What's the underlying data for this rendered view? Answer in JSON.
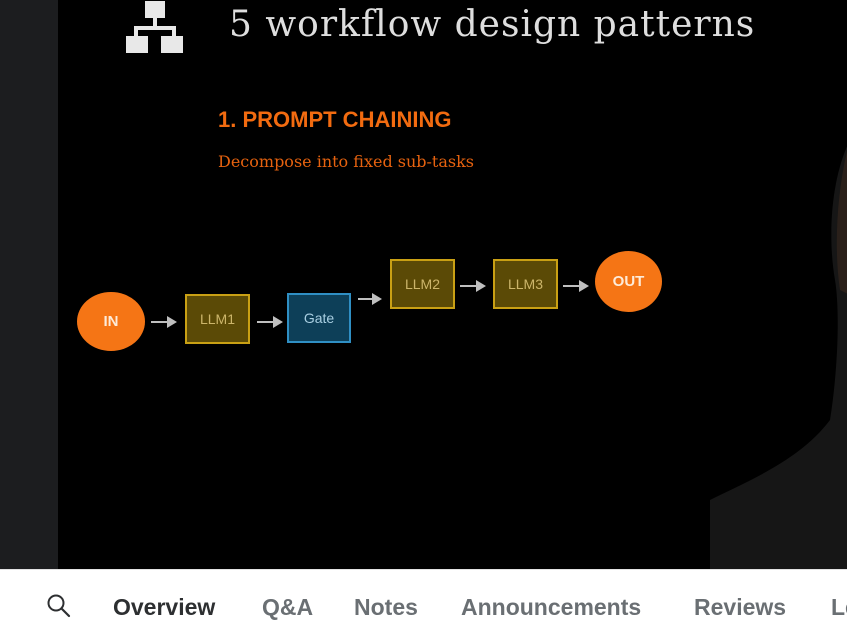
{
  "slide": {
    "title": "5 workflow design patterns",
    "heading": "1. PROMPT CHAINING",
    "subheading": "Decompose into fixed sub-tasks",
    "icon": "hierarchy-icon",
    "flow": {
      "in": "IN",
      "llm1": "LLM1",
      "gate": "Gate",
      "llm2": "LLM2",
      "llm3": "LLM3",
      "out": "OUT"
    },
    "colors": {
      "accent_orange": "#f57515",
      "llm_fill": "#5b4a06",
      "llm_border": "#c9a014",
      "gate_fill": "#0d3f58",
      "gate_border": "#2f8fc4"
    }
  },
  "tabs": {
    "search_icon": "search-icon",
    "items": [
      {
        "label": "Overview",
        "active": true
      },
      {
        "label": "Q&A",
        "active": false
      },
      {
        "label": "Notes",
        "active": false
      },
      {
        "label": "Announcements",
        "active": false
      },
      {
        "label": "Reviews",
        "active": false
      },
      {
        "label": "Le",
        "active": false
      }
    ]
  }
}
